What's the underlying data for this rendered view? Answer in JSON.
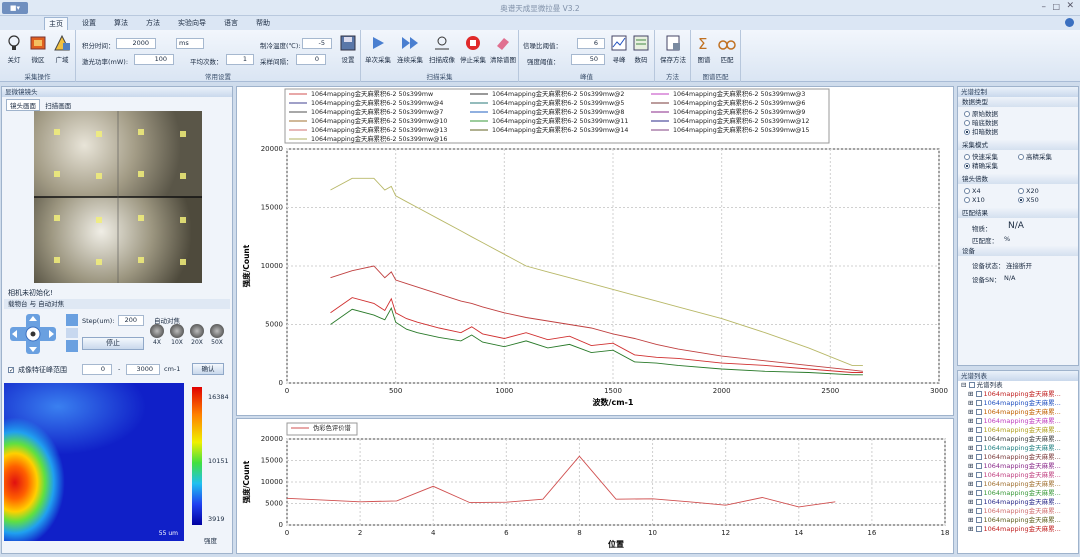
{
  "app": {
    "title": "奥谱天成显微拉曼 V3.2",
    "menu_btn": "■▾"
  },
  "tabs": [
    "主页",
    "设置",
    "算法",
    "方法",
    "实验向导",
    "语言",
    "帮助"
  ],
  "ribbon": {
    "capture_ops": {
      "title": "采集操作",
      "buttons": [
        "关灯",
        "微区",
        "广域"
      ]
    },
    "params": {
      "title": "常用设置",
      "integration_label": "积分时间：",
      "integration_value": "2000",
      "unit": "ms",
      "laser_label": "激光功率(mW):",
      "laser_value": "100",
      "avg_label": "平均次数：",
      "avg_value": "1",
      "cool_label": "制冷温度(℃):",
      "cool_value": "-5",
      "interval_label": "采样间隔：",
      "interval_value": "0",
      "settings": "设置"
    },
    "scan": {
      "title": "扫描采集",
      "buttons": [
        "单次采集",
        "连续采集",
        "扫描成像",
        "停止采集",
        "清除谱图"
      ]
    },
    "peak": {
      "title": "峰值",
      "snr_label": "信噪比阈值：",
      "snr_value": "6",
      "intensity_label": "强度阈值：",
      "intensity_value": "50",
      "buttons": [
        "寻峰",
        "数码"
      ]
    },
    "method": {
      "title": "方法",
      "buttons": [
        "保存方法"
      ]
    },
    "match": {
      "title": "图谱匹配",
      "buttons": [
        "图谱",
        "匹配"
      ]
    }
  },
  "left": {
    "title": "显微镜镜头",
    "tabs": [
      "镜头画面",
      "扫描画面"
    ],
    "status": "相机未初始化!",
    "stage_title": "载物台 与 自动对焦",
    "step_label": "Step(um):",
    "step_value": "200",
    "stop": "停止",
    "autofocus": "自动对焦",
    "mag": [
      "4X",
      "10X",
      "20X",
      "50X"
    ],
    "range_label": "成像特征峰范围",
    "range_from": "0",
    "range_to": "3000",
    "range_unit": "cm-1",
    "confirm": "确认",
    "heatmap": {
      "max": "16384",
      "mid": "10151",
      "min": "3919",
      "legend": "强度",
      "scale": "55 um"
    }
  },
  "main_chart": {
    "legend": [
      "1064mapping金天麻累积6-2  50s399mw",
      "1064mapping金天麻累积6-2  50s399mw@2",
      "1064mapping金天麻累积6-2  50s399mw@3",
      "1064mapping金天麻累积6-2  50s399mw@4",
      "1064mapping金天麻累积6-2  50s399mw@5",
      "1064mapping金天麻累积6-2  50s399mw@6",
      "1064mapping金天麻累积6-2  50s399mw@7",
      "1064mapping金天麻累积6-2  50s399mw@8",
      "1064mapping金天麻累积6-2  50s399mw@9",
      "1064mapping金天麻累积6-2  50s399mw@10",
      "1064mapping金天麻累积6-2  50s399mw@11",
      "1064mapping金天麻累积6-2  50s399mw@12",
      "1064mapping金天麻累积6-2  50s399mw@13",
      "1064mapping金天麻累积6-2  50s399mw@14",
      "1064mapping金天麻累积6-2  50s399mw@15",
      "1064mapping金天麻累积6-2  50s399mw@16"
    ],
    "legend_colors": [
      "#d05050",
      "#333333",
      "#c040c0",
      "#404090",
      "#2a7a7a",
      "#7a3a3a",
      "#505050",
      "#2060c0",
      "#8a2a8a",
      "#a07030",
      "#3a9a3a",
      "#2a2a8a",
      "#d07070",
      "#606020",
      "#804080",
      "#b0b060"
    ]
  },
  "chart_data": [
    {
      "type": "line",
      "title": "",
      "xlabel": "波数/cm-1",
      "ylabel": "强度/Count",
      "xlim": [
        0,
        3000
      ],
      "ylim": [
        0,
        20000
      ],
      "x": [
        200,
        300,
        400,
        450,
        480,
        500,
        550,
        600,
        700,
        800,
        850,
        900,
        1000,
        1100,
        1200,
        1300,
        1400,
        1500,
        1600,
        1700,
        1800,
        2000,
        2200,
        2400,
        2600,
        2650
      ],
      "series": [
        {
          "name": "1064mapping金天麻累积6-2  50s399mw@16",
          "values": [
            16500,
            17500,
            17500,
            16500,
            16800,
            16000,
            15500,
            15000,
            14000,
            13000,
            12500,
            12000,
            11000,
            10000,
            9500,
            9000,
            8500,
            8000,
            7500,
            7000,
            6500,
            5500,
            4300,
            3000,
            1500,
            1500
          ]
        },
        {
          "name": "1064mapping金天麻累积6-2  50s399mw@2",
          "values": [
            9000,
            9600,
            10000,
            9000,
            9500,
            8800,
            8500,
            8200,
            7600,
            7000,
            6800,
            6500,
            6000,
            5600,
            5300,
            5000,
            4700,
            4200,
            3800,
            3300,
            2900,
            2300,
            1900,
            1500,
            1100,
            1000
          ]
        },
        {
          "name": "1064mapping金天麻累积6-2  50s399mw",
          "values": [
            6000,
            7300,
            6800,
            6200,
            7200,
            6000,
            5500,
            5200,
            4700,
            4300,
            4800,
            4200,
            3800,
            4300,
            3700,
            4000,
            3200,
            3400,
            2400,
            2200,
            2100,
            1700,
            1500,
            1200,
            900,
            900
          ]
        },
        {
          "name": "1064mapping金天麻累积6-2  50s399mw@7",
          "values": [
            5000,
            6300,
            5800,
            5400,
            6400,
            5200,
            4600,
            4300,
            3900,
            3600,
            4100,
            3500,
            3100,
            3600,
            3000,
            3300,
            2600,
            2800,
            1800,
            1700,
            1500,
            1200,
            1000,
            900,
            700,
            700
          ]
        }
      ]
    },
    {
      "type": "line",
      "title": "",
      "xlabel": "位置",
      "ylabel": "强度/Count",
      "xlim": [
        0,
        18
      ],
      "ylim": [
        0,
        20000
      ],
      "x": [
        0,
        1,
        2,
        3,
        4,
        5,
        6,
        7,
        8,
        9,
        10,
        11,
        12,
        13,
        14,
        15
      ],
      "series": [
        {
          "name": "伪彩色评价谱",
          "values": [
            6200,
            5800,
            5400,
            5600,
            9000,
            5200,
            5300,
            6000,
            16000,
            6000,
            6100,
            5400,
            4600,
            6400,
            4200,
            5400
          ]
        }
      ]
    }
  ],
  "right": {
    "title": "光谱控制",
    "data_type": {
      "title": "数据类型",
      "options": [
        "原始数据",
        "暗底数据",
        "扣暗数据"
      ],
      "selected": 2
    },
    "acq_mode": {
      "title": "采集模式",
      "options": [
        "快速采集",
        "高精采集",
        "精确采集"
      ],
      "selected": 2
    },
    "lens": {
      "title": "镜头倍数",
      "options": [
        "X4",
        "X20",
        "X10",
        "X50"
      ],
      "selected": 3
    },
    "match": {
      "title": "匹配结果",
      "substance_label": "物质：",
      "substance": "N/A",
      "match_label": "匹配度：",
      "match_unit": "%"
    },
    "device": {
      "title": "设备",
      "status_label": "设备状态：",
      "status": "连接断开",
      "sn_label": "设备SN：",
      "sn": "N/A"
    },
    "list_title": "光谱列表",
    "list_root": "光谱列表",
    "list_items": [
      "1064mapping金天麻累...",
      "1064mapping金天麻累...",
      "1064mapping金天麻累...",
      "1064mapping金天麻累...",
      "1064mapping金天麻累...",
      "1064mapping金天麻累...",
      "1064mapping金天麻累...",
      "1064mapping金天麻累...",
      "1064mapping金天麻累...",
      "1064mapping金天麻累...",
      "1064mapping金天麻累...",
      "1064mapping金天麻累...",
      "1064mapping金天麻累...",
      "1064mapping金天麻累...",
      "1064mapping金天麻累...",
      "1064mapping金天麻累..."
    ],
    "list_colors": [
      "#c02020",
      "#2050c0",
      "#c06000",
      "#c040c0",
      "#b0a020",
      "#404040",
      "#208080",
      "#7a3a3a",
      "#8a2a8a",
      "#c04080",
      "#a07030",
      "#3a9a3a",
      "#2a2a8a",
      "#d07070",
      "#606020",
      "#c02020"
    ]
  }
}
